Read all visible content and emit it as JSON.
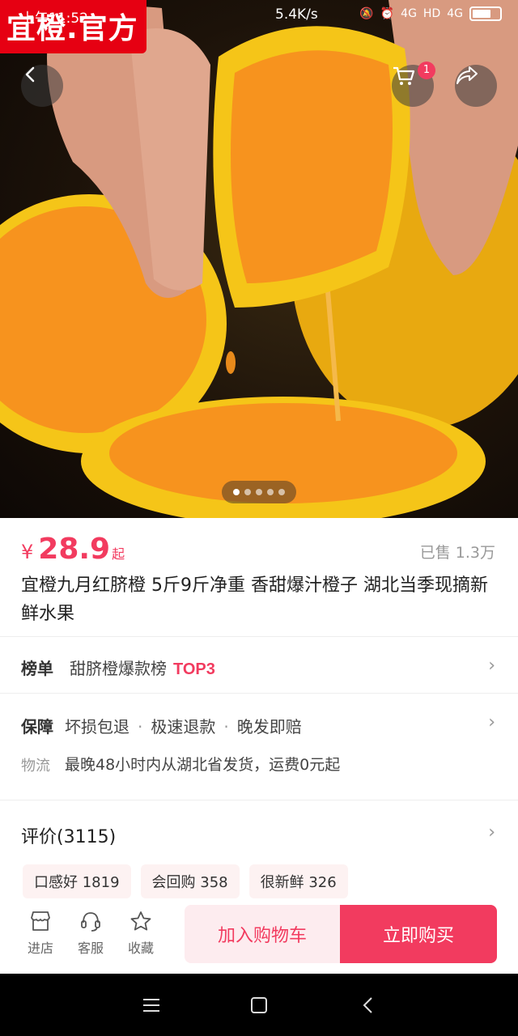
{
  "status_bar": {
    "time": "上午11:52",
    "speed": "5.4K/s",
    "net1": "4G",
    "net2": "HD",
    "net3": "4G"
  },
  "hero": {
    "brand": "宜橙.官方",
    "cart_count": "1",
    "pager": {
      "total": 5,
      "active": 0
    },
    "colors": {
      "orange": "#f7931e",
      "rind": "#f5c518"
    }
  },
  "product": {
    "currency": "¥",
    "price": "28.9",
    "price_suffix": "起",
    "sold": "已售 1.3万",
    "title": "宜橙九月红脐橙 5斤9斤净重 香甜爆汁橙子 湖北当季现摘新鲜水果"
  },
  "ranking": {
    "label": "榜单",
    "text": "甜脐橙爆款榜",
    "tag": "TOP3"
  },
  "guarantee": {
    "label": "保障",
    "items": [
      "坏损包退",
      "极速退款",
      "晚发即赔"
    ],
    "separator": "·"
  },
  "logistics": {
    "label": "物流",
    "text": "最晚48小时内从湖北省发货，运费0元起"
  },
  "reviews": {
    "title": "评价(3115)",
    "tags": [
      "口感好 1819",
      "会回购 358",
      "很新鲜 326"
    ]
  },
  "bottom_bar": {
    "store": "进店",
    "service": "客服",
    "favorite": "收藏",
    "add_to_cart": "加入购物车",
    "buy_now": "立即购买"
  },
  "accent_color": "#f23b5f"
}
